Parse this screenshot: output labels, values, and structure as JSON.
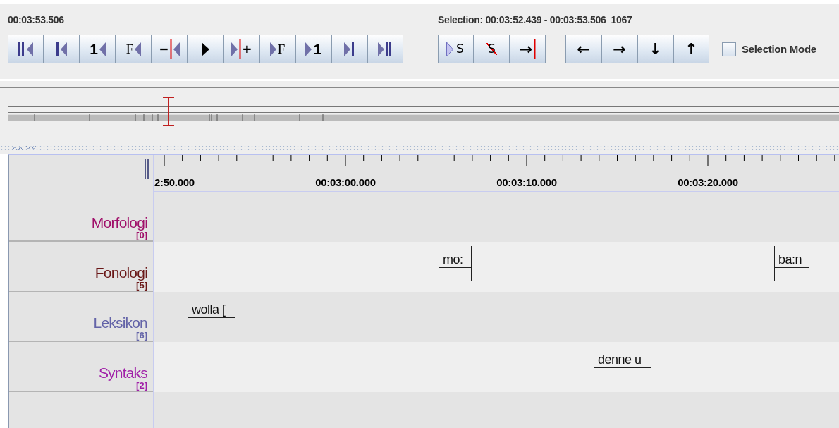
{
  "toolbar": {
    "current_time": "00:03:53.506",
    "media_buttons": [
      {
        "kind": "begin"
      },
      {
        "kind": "prev"
      },
      {
        "kind": "glyph-left",
        "glyph": "1"
      },
      {
        "kind": "glyph-left-serif",
        "glyph": "F"
      },
      {
        "kind": "glyph-red-left",
        "glyph": "−"
      },
      {
        "kind": "play"
      },
      {
        "kind": "right-red-glyph",
        "glyph": "+"
      },
      {
        "kind": "right-glyph-serif",
        "glyph": "F"
      },
      {
        "kind": "right-glyph",
        "glyph": "1"
      },
      {
        "kind": "next"
      },
      {
        "kind": "end"
      }
    ],
    "selection": "Selection: 00:03:52.439 - 00:03:53.506  1067",
    "selection_buttons": [
      {
        "kind": "play-selection",
        "glyph": "S"
      },
      {
        "kind": "clear-selection",
        "glyph": "S"
      },
      {
        "kind": "glyph-red",
        "glyph": "→"
      }
    ],
    "navigation_buttons": [
      {
        "kind": "glyph",
        "glyph": "←"
      },
      {
        "kind": "glyph",
        "glyph": "→"
      },
      {
        "kind": "glyph",
        "glyph": "↓"
      },
      {
        "kind": "glyph",
        "glyph": "↑"
      }
    ],
    "selection_mode": {
      "label": "Selection Mode",
      "checked": false
    }
  },
  "ruler": {
    "labels": [
      "2:50.000",
      "00:03:00.000",
      "00:03:10.000",
      "00:03:20.000"
    ]
  },
  "tiers": [
    {
      "name": "Morfologi",
      "count": "[0]",
      "color": "#a0106a"
    },
    {
      "name": "Fonologi",
      "count": "[5]",
      "color": "#6a1818",
      "annotations": [
        {
          "text": "mo:"
        },
        {
          "text": "ba:n"
        }
      ]
    },
    {
      "name": "Leksikon",
      "count": "[6]",
      "color": "#6464a8",
      "annotations": [
        {
          "text": "wolla ["
        }
      ]
    },
    {
      "name": "Syntaks",
      "count": "[2]",
      "color": "#a020a8",
      "annotations": [
        {
          "text": "denne u"
        }
      ]
    }
  ]
}
